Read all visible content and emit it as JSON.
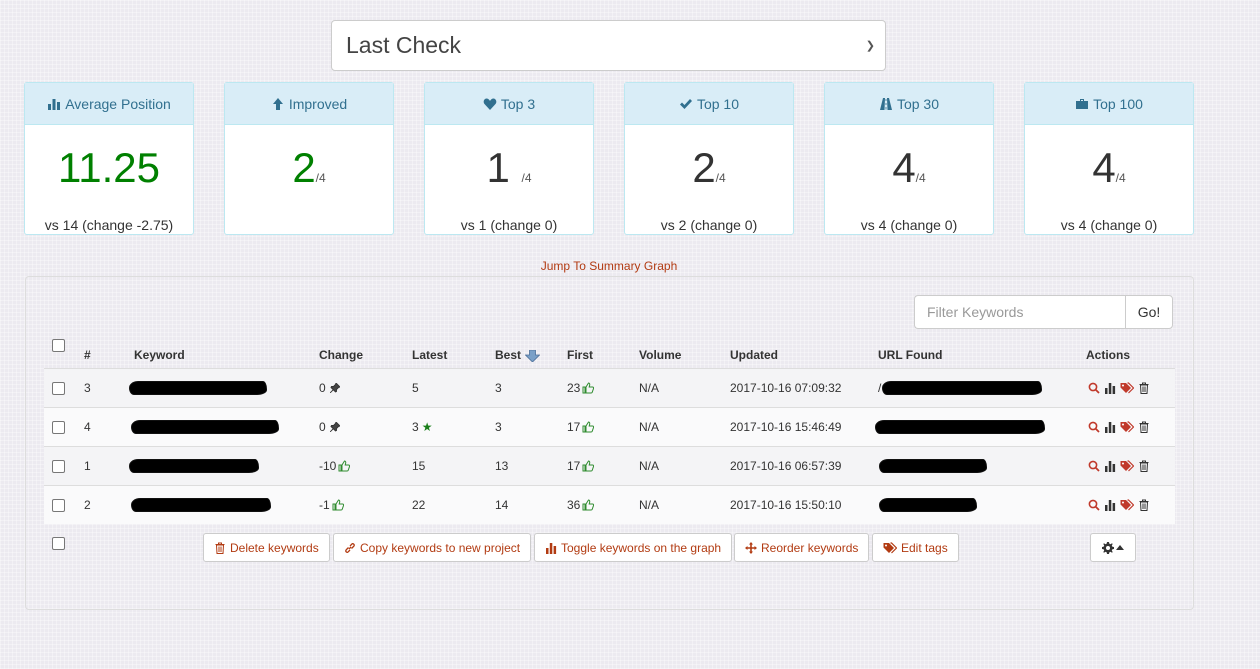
{
  "select": {
    "value": "Last Check"
  },
  "cards": [
    {
      "title": "Average Position",
      "icon": "bar-chart-icon",
      "big": "11.25",
      "denominator": "",
      "sub": "vs 14 (change -2.75)",
      "green": true
    },
    {
      "title": "Improved",
      "icon": "arrow-up-icon",
      "big": "2",
      "denominator": "/4",
      "sub": "",
      "green": true
    },
    {
      "title": "Top 3",
      "icon": "heart-icon",
      "big": "1",
      "denominator": "/4",
      "sub": "vs 1 (change 0)",
      "green": false
    },
    {
      "title": "Top 10",
      "icon": "check-icon",
      "big": "2",
      "denominator": "/4",
      "sub": "vs 2 (change 0)",
      "green": false
    },
    {
      "title": "Top 30",
      "icon": "road-icon",
      "big": "4",
      "denominator": "/4",
      "sub": "vs 4 (change 0)",
      "green": false
    },
    {
      "title": "Top 100",
      "icon": "briefcase-icon",
      "big": "4",
      "denominator": "/4",
      "sub": "vs 4 (change 0)",
      "green": false
    }
  ],
  "jump_link": "Jump To Summary Graph",
  "filter": {
    "placeholder": "Filter Keywords",
    "go_label": "Go!"
  },
  "table": {
    "headers": {
      "num": "#",
      "keyword": "Keyword",
      "change": "Change",
      "latest": "Latest",
      "best": "Best",
      "first": "First",
      "volume": "Volume",
      "updated": "Updated",
      "url": "URL Found",
      "actions": "Actions"
    },
    "rows": [
      {
        "num": "3",
        "change": "0",
        "change_icon": "pin-icon",
        "latest": "5",
        "latest_star": false,
        "best": "3",
        "first": "23",
        "volume": "N/A",
        "updated": "2017-10-16 07:09:32"
      },
      {
        "num": "4",
        "change": "0",
        "change_icon": "pin-icon",
        "latest": "3",
        "latest_star": true,
        "best": "3",
        "first": "17",
        "volume": "N/A",
        "updated": "2017-10-16 15:46:49"
      },
      {
        "num": "1",
        "change": "-10",
        "change_icon": "thumbs-up-icon",
        "latest": "15",
        "latest_star": false,
        "best": "13",
        "first": "17",
        "volume": "N/A",
        "updated": "2017-10-16 06:57:39"
      },
      {
        "num": "2",
        "change": "-1",
        "change_icon": "thumbs-up-icon",
        "latest": "22",
        "latest_star": false,
        "best": "14",
        "first": "36",
        "volume": "N/A",
        "updated": "2017-10-16 15:50:10"
      }
    ]
  },
  "buttons": {
    "delete": "Delete keywords",
    "copy": "Copy keywords to new project",
    "toggle": "Toggle keywords on the graph",
    "reorder": "Reorder keywords",
    "edit_tags": "Edit tags"
  },
  "colors": {
    "accent": "#b23b12",
    "card_header": "#d9edf7",
    "card_header_text": "#31708f",
    "green": "#008000"
  }
}
